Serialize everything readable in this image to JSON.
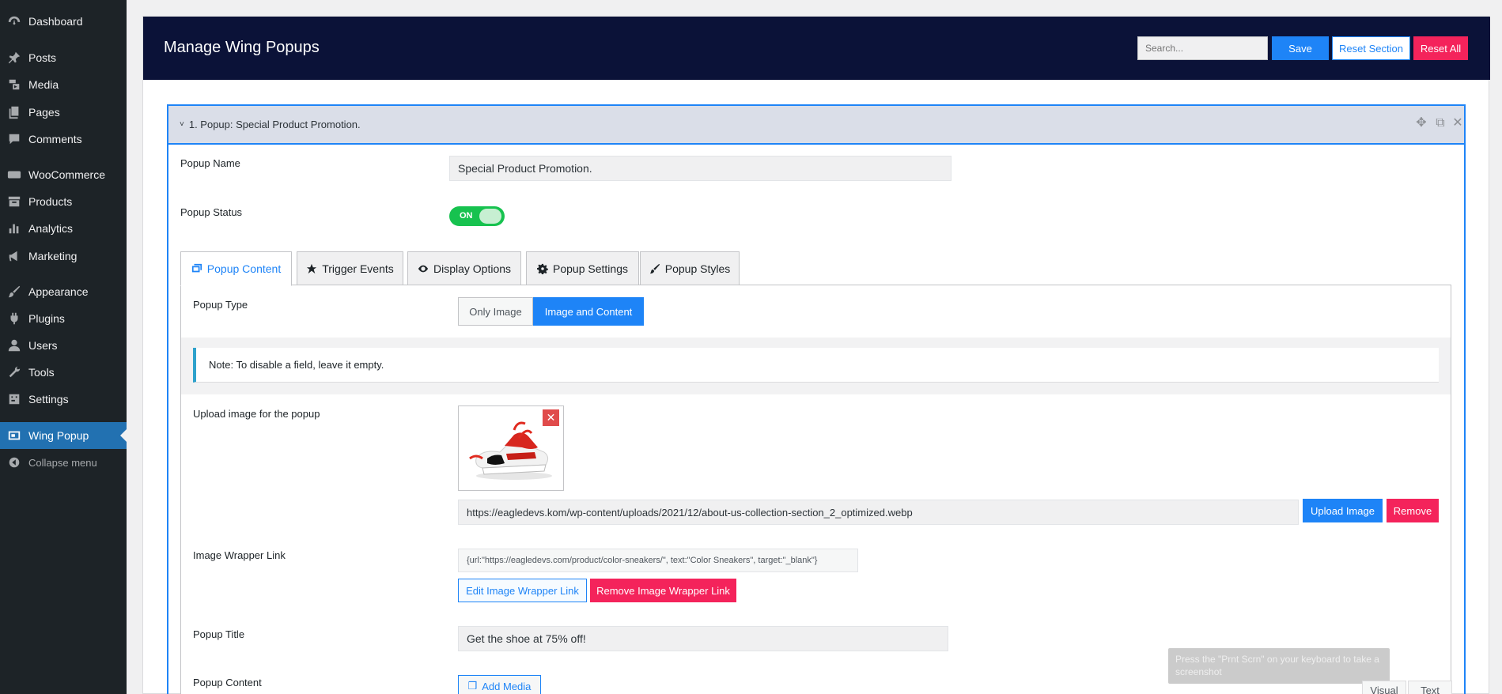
{
  "sidebar": {
    "items": [
      {
        "label": "Dashboard",
        "icon": "dashboard-icon"
      },
      {
        "label": "Posts",
        "icon": "pin-icon"
      },
      {
        "label": "Media",
        "icon": "media-icon"
      },
      {
        "label": "Pages",
        "icon": "pages-icon"
      },
      {
        "label": "Comments",
        "icon": "comment-icon"
      },
      {
        "label": "WooCommerce",
        "icon": "woo-icon"
      },
      {
        "label": "Products",
        "icon": "archive-icon"
      },
      {
        "label": "Analytics",
        "icon": "bar-chart-icon"
      },
      {
        "label": "Marketing",
        "icon": "megaphone-icon"
      },
      {
        "label": "Appearance",
        "icon": "brush-icon"
      },
      {
        "label": "Plugins",
        "icon": "plug-icon"
      },
      {
        "label": "Users",
        "icon": "user-icon"
      },
      {
        "label": "Tools",
        "icon": "wrench-icon"
      },
      {
        "label": "Settings",
        "icon": "sliders-icon"
      },
      {
        "label": "Wing Popup",
        "icon": "popup-icon"
      },
      {
        "label": "Collapse menu",
        "icon": "collapse-icon"
      }
    ],
    "active_item": "Wing Popup"
  },
  "header": {
    "title": "Manage Wing Popups",
    "search_placeholder": "Search...",
    "save_label": "Save",
    "reset_section_label": "Reset Section",
    "reset_all_label": "Reset All"
  },
  "accordion": {
    "title": "1. Popup: Special Product Promotion."
  },
  "form": {
    "popup_name_label": "Popup Name",
    "popup_name_value": "Special Product Promotion.",
    "popup_status_label": "Popup Status",
    "popup_status_value": "ON",
    "tabs": [
      {
        "label": "Popup Content",
        "icon": "image-icon"
      },
      {
        "label": "Trigger Events",
        "icon": "star-icon"
      },
      {
        "label": "Display Options",
        "icon": "eye-icon"
      },
      {
        "label": "Popup Settings",
        "icon": "gear-icon"
      },
      {
        "label": "Popup Styles",
        "icon": "brush-icon"
      }
    ],
    "active_tab": "Popup Content",
    "popup_type_label": "Popup Type",
    "popup_type_options": [
      "Only Image",
      "Image and Content"
    ],
    "popup_type_selected": "Image and Content",
    "note": "Note: To disable a field, leave it empty.",
    "upload_label": "Upload image for the popup",
    "image_url": "https://eagledevs.kom/wp-content/uploads/2021/12/about-us-collection-section_2_optimized.webp",
    "upload_button": "Upload Image",
    "remove_button": "Remove",
    "wrapper_link_label": "Image Wrapper Link",
    "wrapper_link_value": "{url:\"https://eagledevs.com/product/color-sneakers/\", text:\"Color Sneakers\", target:\"_blank\"}",
    "edit_wrapper_button": "Edit Image Wrapper Link",
    "remove_wrapper_button": "Remove Image Wrapper Link",
    "popup_title_label": "Popup Title",
    "popup_title_value": "Get the shoe at 75% off!",
    "popup_content_label": "Popup Content",
    "add_media_button": "Add Media",
    "editor_tabs": [
      "Visual",
      "Text"
    ]
  },
  "tooltip": {
    "text": "Press the \"Prnt Scrn\" on your keyboard to take a screenshot"
  },
  "colors": {
    "header_bg": "#0b1238",
    "accent_blue": "#1e84f7",
    "danger_red": "#f4235b",
    "toggle_green": "#17c24f",
    "sidebar_bg": "#1d2327",
    "sidebar_active": "#2271b1"
  }
}
